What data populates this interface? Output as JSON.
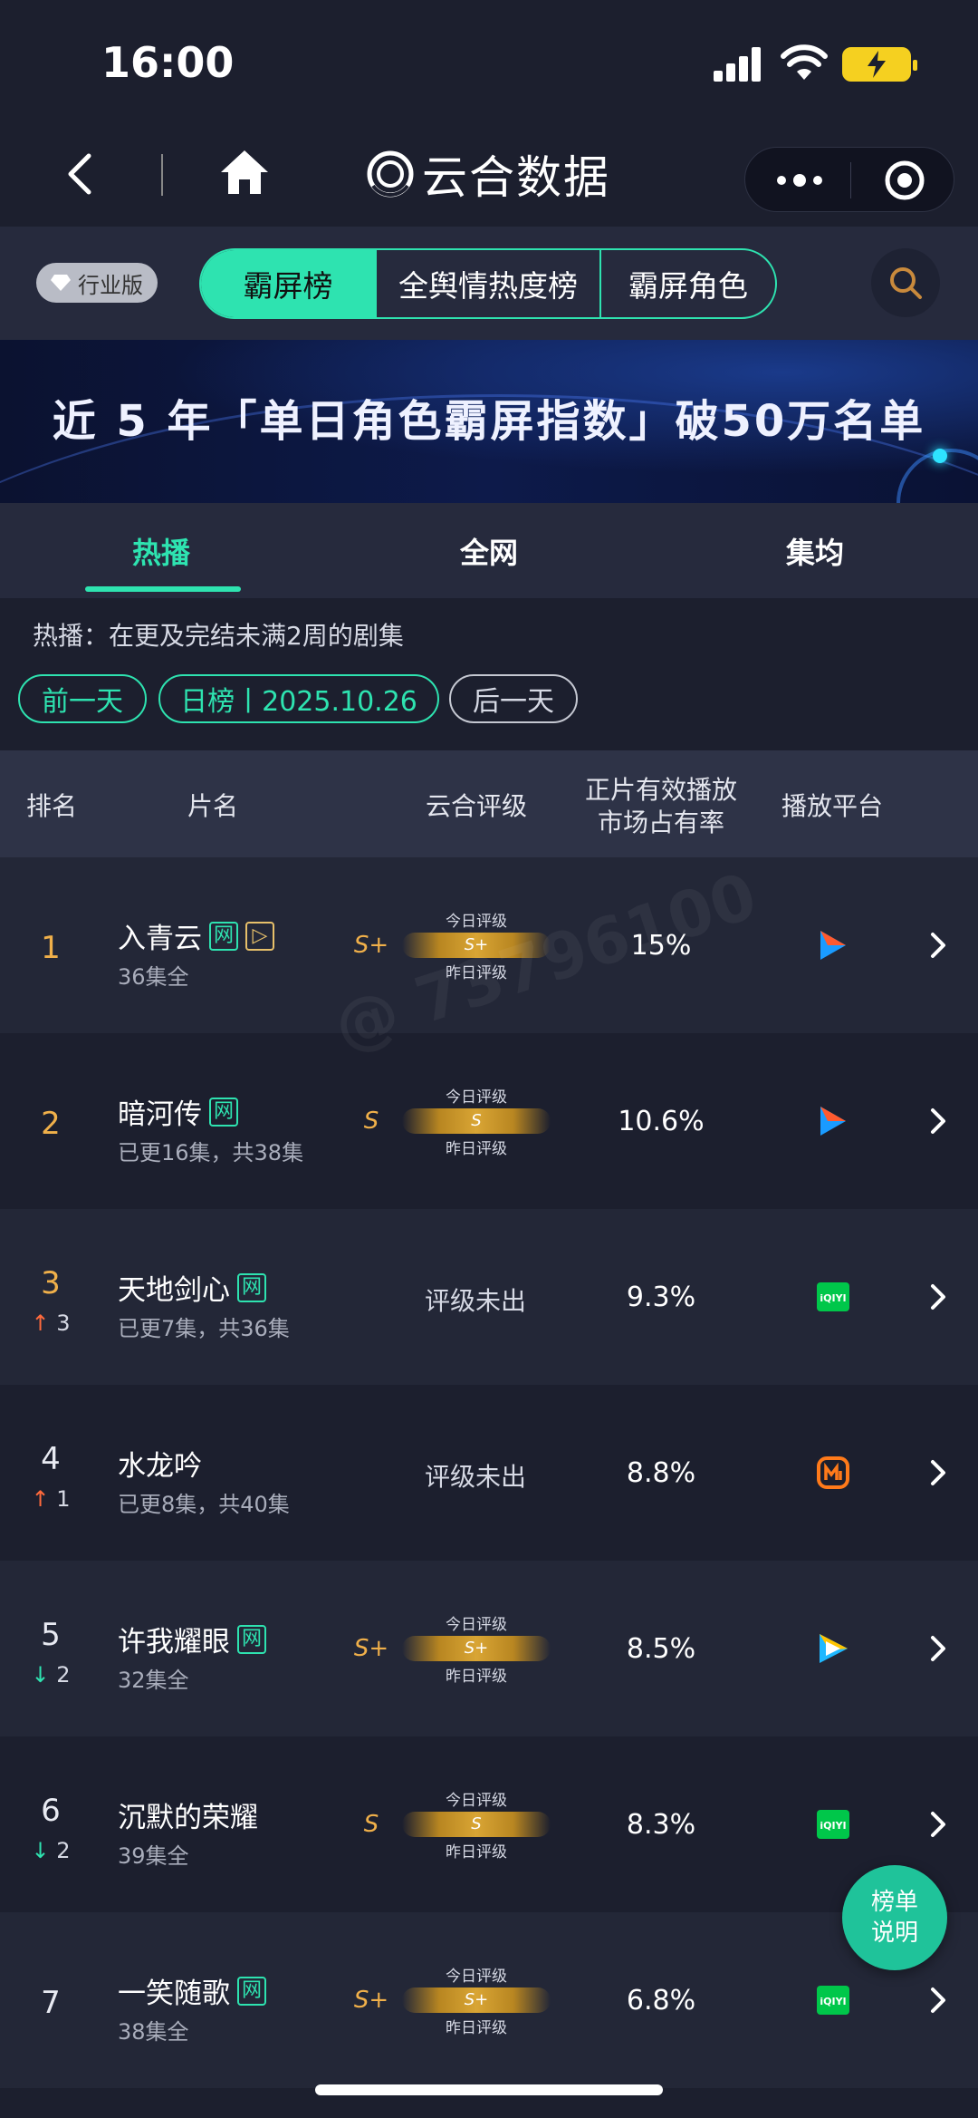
{
  "status": {
    "time": "16:00"
  },
  "nav": {
    "brand": "云合数据"
  },
  "toolbar": {
    "badge": "行业版",
    "segments": [
      "霸屏榜",
      "全舆情热度榜",
      "霸屏角色"
    ]
  },
  "banner": {
    "text": "近 5 年「单日角色霸屏指数」破50万名单"
  },
  "tabs": [
    "热播",
    "全网",
    "集均"
  ],
  "note": "热播：在更及完结未满2周的剧集",
  "date": {
    "prev": "前一天",
    "current": "日榜丨2025.10.26",
    "next": "后一天"
  },
  "table": {
    "headers": {
      "rank": "排名",
      "title": "片名",
      "rating": "云合评级",
      "share_l1": "正片有效播放",
      "share_l2": "市场占有率",
      "platform": "播放平台"
    },
    "gauge_today": "今日评级",
    "gauge_yesterday": "昨日评级",
    "rows": [
      {
        "rank": "1",
        "trend": "",
        "title": "入青云",
        "tags": [
          "网",
          "▷"
        ],
        "sub": "36集全",
        "grade": "S+",
        "gauge": "S+",
        "share": "15%",
        "platform": "youku-icon"
      },
      {
        "rank": "2",
        "trend": "",
        "title": "暗河传",
        "tags": [
          "网"
        ],
        "sub": "已更16集，共38集",
        "grade": "S",
        "gauge": "S",
        "share": "10.6%",
        "platform": "youku-icon"
      },
      {
        "rank": "3",
        "trend": "3",
        "trend_dir": "up",
        "title": "天地剑心",
        "tags": [
          "网"
        ],
        "sub": "已更7集，共36集",
        "rating_text": "评级未出",
        "share": "9.3%",
        "platform": "iqiyi-icon"
      },
      {
        "rank": "4",
        "trend": "1",
        "trend_dir": "up",
        "title": "水龙吟",
        "tags": [],
        "sub": "已更8集，共40集",
        "rating_text": "评级未出",
        "share": "8.8%",
        "platform": "mango-icon"
      },
      {
        "rank": "5",
        "trend": "2",
        "trend_dir": "down",
        "title": "许我耀眼",
        "tags": [
          "网"
        ],
        "sub": "32集全",
        "grade": "S+",
        "gauge": "S+",
        "share": "8.5%",
        "platform": "tencent-video-icon"
      },
      {
        "rank": "6",
        "trend": "2",
        "trend_dir": "down",
        "title": "沉默的荣耀",
        "tags": [],
        "sub": "39集全",
        "grade": "S",
        "gauge": "S",
        "share": "8.3%",
        "platform": "iqiyi-icon"
      },
      {
        "rank": "7",
        "trend": "",
        "title": "一笑随歌",
        "tags": [
          "网"
        ],
        "sub": "38集全",
        "grade": "S+",
        "gauge": "S+",
        "share": "6.8%",
        "platform": "iqiyi-icon"
      }
    ]
  },
  "fab": {
    "l1": "榜单",
    "l2": "说明"
  }
}
